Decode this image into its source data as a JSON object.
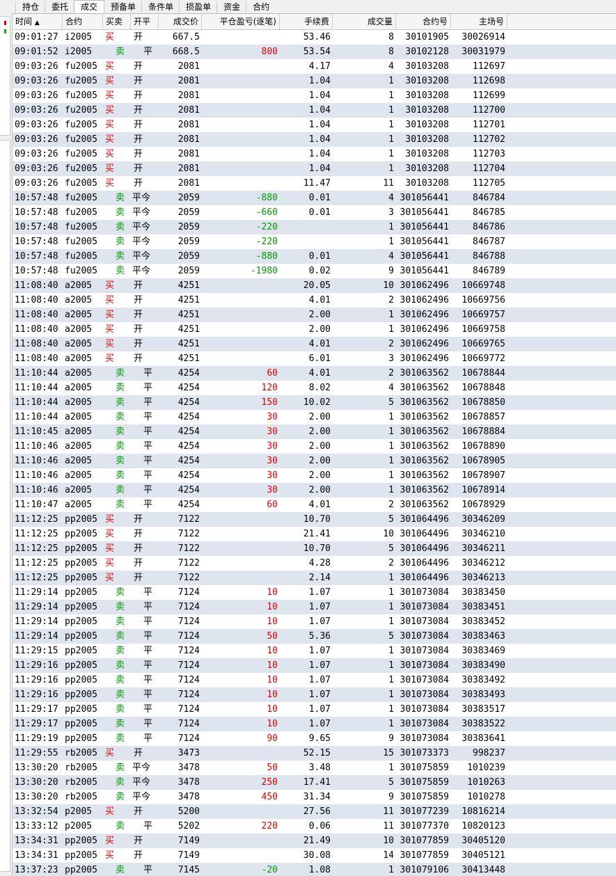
{
  "tabs": [
    {
      "label": "持仓",
      "active": false
    },
    {
      "label": "委托",
      "active": false
    },
    {
      "label": "成交",
      "active": true
    },
    {
      "label": "预备单",
      "active": false
    },
    {
      "label": "条件单",
      "active": false
    },
    {
      "label": "损盈单",
      "active": false
    },
    {
      "label": "资金",
      "active": false
    },
    {
      "label": "合约",
      "active": false
    }
  ],
  "columns": [
    {
      "label": "时间",
      "align": "l",
      "sort_icon": "sort-asc-icon",
      "sort_glyph": "▲"
    },
    {
      "label": "合约",
      "align": "l"
    },
    {
      "label": "买卖",
      "align": "l"
    },
    {
      "label": "开平",
      "align": "l"
    },
    {
      "label": "成交价",
      "align": "r"
    },
    {
      "label": "平仓盈亏(逐笔)",
      "align": "r"
    },
    {
      "label": "手续费",
      "align": "r"
    },
    {
      "label": "成交量",
      "align": "r"
    },
    {
      "label": "合约号",
      "align": "r"
    },
    {
      "label": "主场号",
      "align": "r"
    }
  ],
  "colors": {
    "buy": "#ee0000",
    "sell": "#009900",
    "profit": "#e00000",
    "loss": "#009900",
    "row_alt": "#dfe5ef",
    "row_base": "#ffffff"
  },
  "rows": [
    [
      "09:01:27",
      "i2005",
      "买",
      "开",
      "667.5",
      "",
      "53.46",
      "8",
      "30101905",
      "30026914"
    ],
    [
      "09:01:52",
      "i2005",
      "卖",
      "平",
      "668.5",
      "800",
      "53.54",
      "8",
      "30102128",
      "30031979"
    ],
    [
      "09:03:26",
      "fu2005",
      "买",
      "开",
      "2081",
      "",
      "4.17",
      "4",
      "30103208",
      "112697"
    ],
    [
      "09:03:26",
      "fu2005",
      "买",
      "开",
      "2081",
      "",
      "1.04",
      "1",
      "30103208",
      "112698"
    ],
    [
      "09:03:26",
      "fu2005",
      "买",
      "开",
      "2081",
      "",
      "1.04",
      "1",
      "30103208",
      "112699"
    ],
    [
      "09:03:26",
      "fu2005",
      "买",
      "开",
      "2081",
      "",
      "1.04",
      "1",
      "30103208",
      "112700"
    ],
    [
      "09:03:26",
      "fu2005",
      "买",
      "开",
      "2081",
      "",
      "1.04",
      "1",
      "30103208",
      "112701"
    ],
    [
      "09:03:26",
      "fu2005",
      "买",
      "开",
      "2081",
      "",
      "1.04",
      "1",
      "30103208",
      "112702"
    ],
    [
      "09:03:26",
      "fu2005",
      "买",
      "开",
      "2081",
      "",
      "1.04",
      "1",
      "30103208",
      "112703"
    ],
    [
      "09:03:26",
      "fu2005",
      "买",
      "开",
      "2081",
      "",
      "1.04",
      "1",
      "30103208",
      "112704"
    ],
    [
      "09:03:26",
      "fu2005",
      "买",
      "开",
      "2081",
      "",
      "11.47",
      "11",
      "30103208",
      "112705"
    ],
    [
      "10:57:48",
      "fu2005",
      "卖",
      "平今",
      "2059",
      "-880",
      "0.01",
      "4",
      "301056441",
      "846784"
    ],
    [
      "10:57:48",
      "fu2005",
      "卖",
      "平今",
      "2059",
      "-660",
      "0.01",
      "3",
      "301056441",
      "846785"
    ],
    [
      "10:57:48",
      "fu2005",
      "卖",
      "平今",
      "2059",
      "-220",
      "",
      "1",
      "301056441",
      "846786"
    ],
    [
      "10:57:48",
      "fu2005",
      "卖",
      "平今",
      "2059",
      "-220",
      "",
      "1",
      "301056441",
      "846787"
    ],
    [
      "10:57:48",
      "fu2005",
      "卖",
      "平今",
      "2059",
      "-880",
      "0.01",
      "4",
      "301056441",
      "846788"
    ],
    [
      "10:57:48",
      "fu2005",
      "卖",
      "平今",
      "2059",
      "-1980",
      "0.02",
      "9",
      "301056441",
      "846789"
    ],
    [
      "11:08:40",
      "a2005",
      "买",
      "开",
      "4251",
      "",
      "20.05",
      "10",
      "301062496",
      "10669748"
    ],
    [
      "11:08:40",
      "a2005",
      "买",
      "开",
      "4251",
      "",
      "4.01",
      "2",
      "301062496",
      "10669756"
    ],
    [
      "11:08:40",
      "a2005",
      "买",
      "开",
      "4251",
      "",
      "2.00",
      "1",
      "301062496",
      "10669757"
    ],
    [
      "11:08:40",
      "a2005",
      "买",
      "开",
      "4251",
      "",
      "2.00",
      "1",
      "301062496",
      "10669758"
    ],
    [
      "11:08:40",
      "a2005",
      "买",
      "开",
      "4251",
      "",
      "4.01",
      "2",
      "301062496",
      "10669765"
    ],
    [
      "11:08:40",
      "a2005",
      "买",
      "开",
      "4251",
      "",
      "6.01",
      "3",
      "301062496",
      "10669772"
    ],
    [
      "11:10:44",
      "a2005",
      "卖",
      "平",
      "4254",
      "60",
      "4.01",
      "2",
      "301063562",
      "10678844"
    ],
    [
      "11:10:44",
      "a2005",
      "卖",
      "平",
      "4254",
      "120",
      "8.02",
      "4",
      "301063562",
      "10678848"
    ],
    [
      "11:10:44",
      "a2005",
      "卖",
      "平",
      "4254",
      "150",
      "10.02",
      "5",
      "301063562",
      "10678850"
    ],
    [
      "11:10:44",
      "a2005",
      "卖",
      "平",
      "4254",
      "30",
      "2.00",
      "1",
      "301063562",
      "10678857"
    ],
    [
      "11:10:45",
      "a2005",
      "卖",
      "平",
      "4254",
      "30",
      "2.00",
      "1",
      "301063562",
      "10678884"
    ],
    [
      "11:10:46",
      "a2005",
      "卖",
      "平",
      "4254",
      "30",
      "2.00",
      "1",
      "301063562",
      "10678890"
    ],
    [
      "11:10:46",
      "a2005",
      "卖",
      "平",
      "4254",
      "30",
      "2.00",
      "1",
      "301063562",
      "10678905"
    ],
    [
      "11:10:46",
      "a2005",
      "卖",
      "平",
      "4254",
      "30",
      "2.00",
      "1",
      "301063562",
      "10678907"
    ],
    [
      "11:10:46",
      "a2005",
      "卖",
      "平",
      "4254",
      "30",
      "2.00",
      "1",
      "301063562",
      "10678914"
    ],
    [
      "11:10:47",
      "a2005",
      "卖",
      "平",
      "4254",
      "60",
      "4.01",
      "2",
      "301063562",
      "10678929"
    ],
    [
      "11:12:25",
      "pp2005",
      "买",
      "开",
      "7122",
      "",
      "10.70",
      "5",
      "301064496",
      "30346209"
    ],
    [
      "11:12:25",
      "pp2005",
      "买",
      "开",
      "7122",
      "",
      "21.41",
      "10",
      "301064496",
      "30346210"
    ],
    [
      "11:12:25",
      "pp2005",
      "买",
      "开",
      "7122",
      "",
      "10.70",
      "5",
      "301064496",
      "30346211"
    ],
    [
      "11:12:25",
      "pp2005",
      "买",
      "开",
      "7122",
      "",
      "4.28",
      "2",
      "301064496",
      "30346212"
    ],
    [
      "11:12:25",
      "pp2005",
      "买",
      "开",
      "7122",
      "",
      "2.14",
      "1",
      "301064496",
      "30346213"
    ],
    [
      "11:29:14",
      "pp2005",
      "卖",
      "平",
      "7124",
      "10",
      "1.07",
      "1",
      "301073084",
      "30383450"
    ],
    [
      "11:29:14",
      "pp2005",
      "卖",
      "平",
      "7124",
      "10",
      "1.07",
      "1",
      "301073084",
      "30383451"
    ],
    [
      "11:29:14",
      "pp2005",
      "卖",
      "平",
      "7124",
      "10",
      "1.07",
      "1",
      "301073084",
      "30383452"
    ],
    [
      "11:29:14",
      "pp2005",
      "卖",
      "平",
      "7124",
      "50",
      "5.36",
      "5",
      "301073084",
      "30383463"
    ],
    [
      "11:29:15",
      "pp2005",
      "卖",
      "平",
      "7124",
      "10",
      "1.07",
      "1",
      "301073084",
      "30383469"
    ],
    [
      "11:29:16",
      "pp2005",
      "卖",
      "平",
      "7124",
      "10",
      "1.07",
      "1",
      "301073084",
      "30383490"
    ],
    [
      "11:29:16",
      "pp2005",
      "卖",
      "平",
      "7124",
      "10",
      "1.07",
      "1",
      "301073084",
      "30383492"
    ],
    [
      "11:29:16",
      "pp2005",
      "卖",
      "平",
      "7124",
      "10",
      "1.07",
      "1",
      "301073084",
      "30383493"
    ],
    [
      "11:29:17",
      "pp2005",
      "卖",
      "平",
      "7124",
      "10",
      "1.07",
      "1",
      "301073084",
      "30383517"
    ],
    [
      "11:29:17",
      "pp2005",
      "卖",
      "平",
      "7124",
      "10",
      "1.07",
      "1",
      "301073084",
      "30383522"
    ],
    [
      "11:29:19",
      "pp2005",
      "卖",
      "平",
      "7124",
      "90",
      "9.65",
      "9",
      "301073084",
      "30383641"
    ],
    [
      "11:29:55",
      "rb2005",
      "买",
      "开",
      "3473",
      "",
      "52.15",
      "15",
      "301073373",
      "998237"
    ],
    [
      "13:30:20",
      "rb2005",
      "卖",
      "平今",
      "3478",
      "50",
      "3.48",
      "1",
      "301075859",
      "1010239"
    ],
    [
      "13:30:20",
      "rb2005",
      "卖",
      "平今",
      "3478",
      "250",
      "17.41",
      "5",
      "301075859",
      "1010263"
    ],
    [
      "13:30:20",
      "rb2005",
      "卖",
      "平今",
      "3478",
      "450",
      "31.34",
      "9",
      "301075859",
      "1010278"
    ],
    [
      "13:32:54",
      "p2005",
      "买",
      "开",
      "5200",
      "",
      "27.56",
      "11",
      "301077239",
      "10816214"
    ],
    [
      "13:33:12",
      "p2005",
      "卖",
      "平",
      "5202",
      "220",
      "0.06",
      "11",
      "301077370",
      "10820123"
    ],
    [
      "13:34:31",
      "pp2005",
      "买",
      "开",
      "7149",
      "",
      "21.49",
      "10",
      "301077859",
      "30405120"
    ],
    [
      "13:34:31",
      "pp2005",
      "买",
      "开",
      "7149",
      "",
      "30.08",
      "14",
      "301077859",
      "30405121"
    ],
    [
      "13:37:23",
      "pp2005",
      "卖",
      "平",
      "7145",
      "-20",
      "1.08",
      "1",
      "301079106",
      "30413448"
    ]
  ]
}
